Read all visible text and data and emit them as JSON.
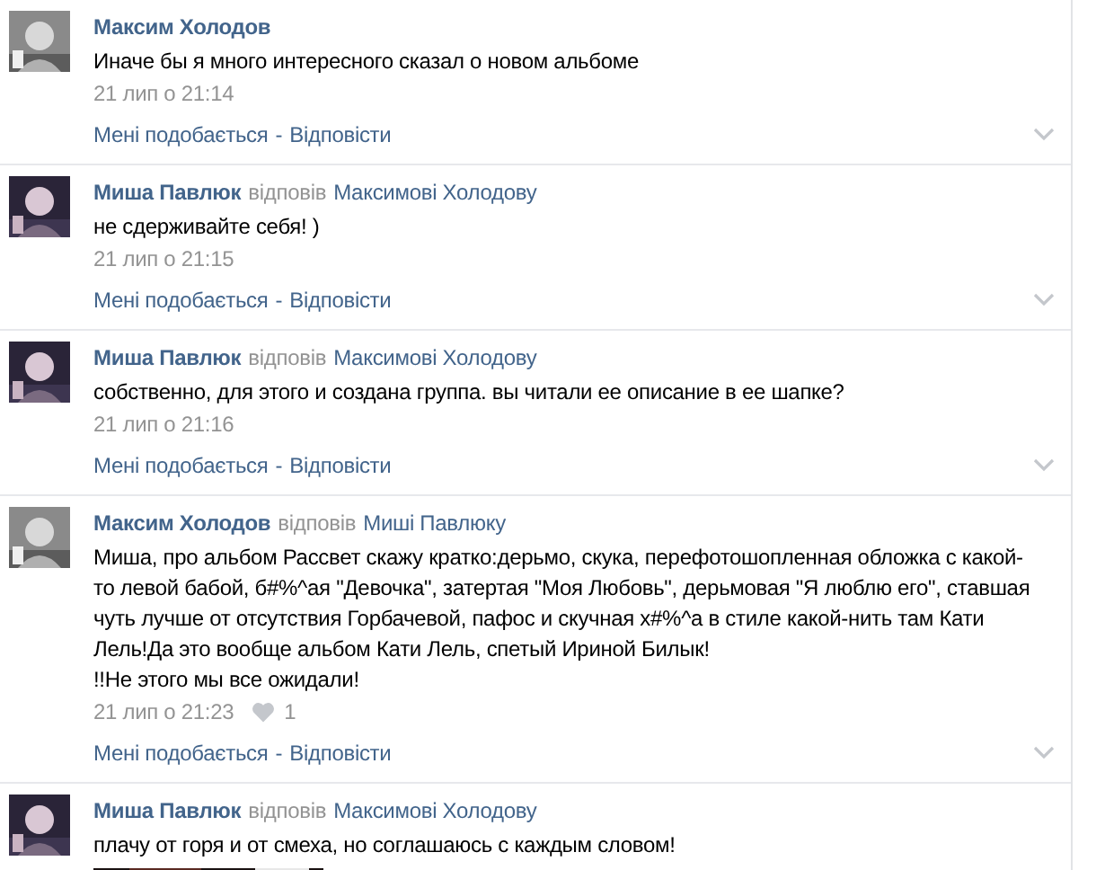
{
  "action_separator": "-",
  "comments": [
    {
      "author": "Максим Холодов",
      "text": "Иначе бы я много интересного сказал о новом альбоме",
      "date": "21 лип о 21:14",
      "actions": [
        "Мені подобається",
        "Відповісти"
      ]
    },
    {
      "author": "Миша Павлюк",
      "reply_word": "відповів",
      "reply_to": "Максимові Холодову",
      "text": "не сдерживайте себя! )",
      "date": "21 лип о 21:15",
      "actions": [
        "Мені подобається",
        "Відповісти"
      ]
    },
    {
      "author": "Миша Павлюк",
      "reply_word": "відповів",
      "reply_to": "Максимові Холодову",
      "text": "собственно, для этого и создана группа. вы читали ее описание в ее шапке?",
      "date": "21 лип о 21:16",
      "actions": [
        "Мені подобається",
        "Відповісти"
      ]
    },
    {
      "author": "Максим Холодов",
      "reply_word": "відповів",
      "reply_to": "Миші Павлюку",
      "text": "Миша, про альбом Рассвет скажу кратко:дерьмо, скука, перефотошопленная обложка с какой-то левой бабой, б#%^ая \"Девочка\", затертая \"Моя Любовь\", дерьмовая \"Я люблю его\", ставшая чуть лучше от отсутствия Горбачевой, пафос и скучная х#%^а в стиле какой-нить там Кати Лель!Да это вообще альбом Кати Лель, спетый Ириной Билык!\n!!Не этого мы все ожидали!",
      "date": "21 лип о 21:23",
      "likes": "1",
      "actions": [
        "Мені подобається",
        "Відповісти"
      ]
    },
    {
      "author": "Миша Павлюк",
      "reply_word": "відповів",
      "reply_to": "Максимові Холодову",
      "text": "плачу от горя и от смеха, но соглашаюсь с каждым словом!"
    }
  ]
}
